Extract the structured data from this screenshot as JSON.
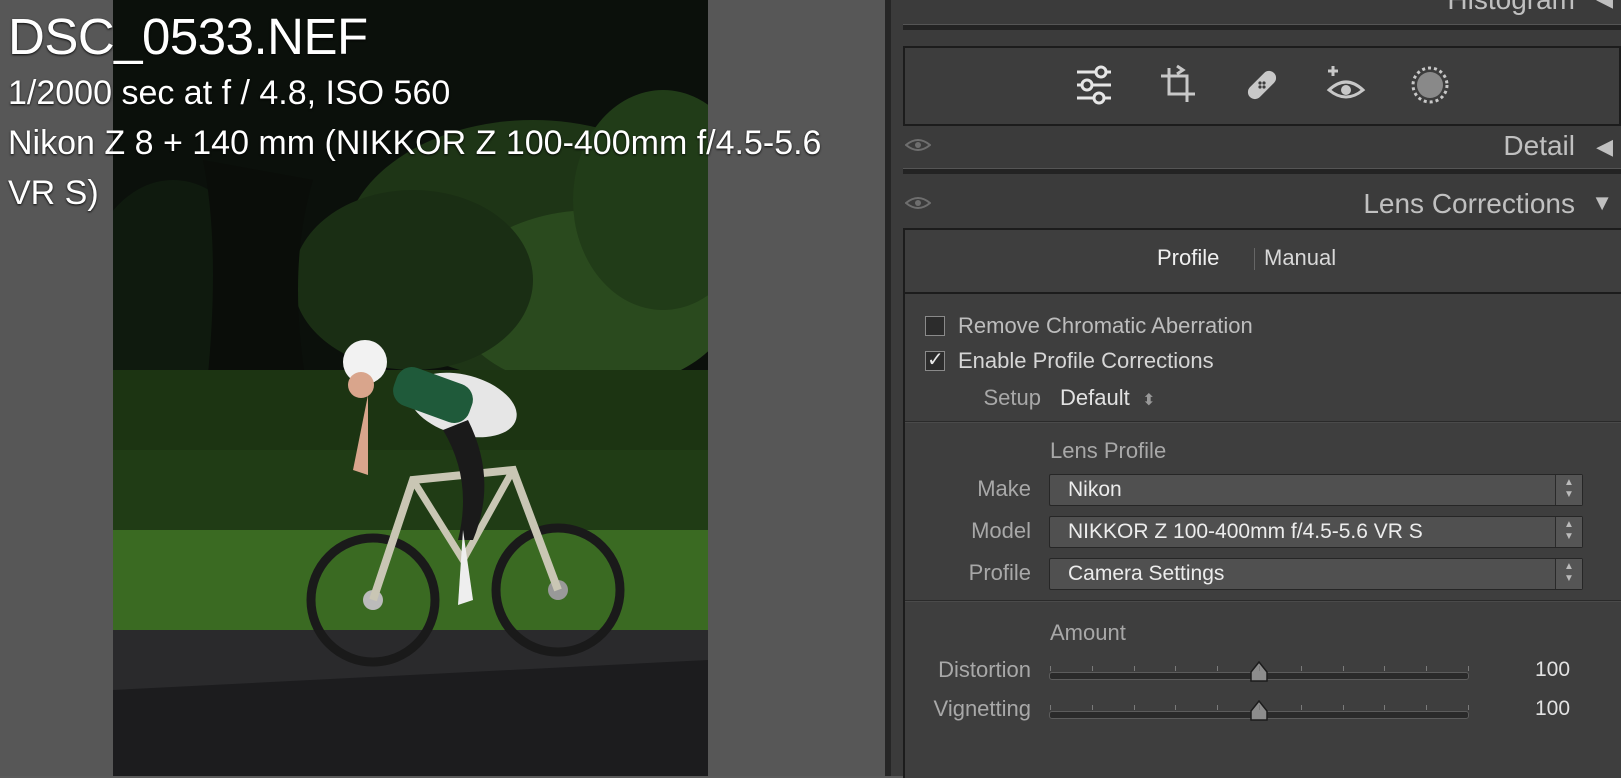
{
  "image_info": {
    "filename": "DSC_0533.NEF",
    "exposure": "1/2000 sec at f / 4.8, ISO 560",
    "camera": "Nikon Z 8 + 140 mm (NIKKOR Z 100-400mm f/4.5-5.6 VR S)"
  },
  "panels": {
    "histogram": {
      "title": "Histogram",
      "arrow": "◀"
    },
    "detail": {
      "title": "Detail",
      "arrow": "◀"
    },
    "lens_corrections": {
      "title": "Lens Corrections",
      "arrow": "▼"
    }
  },
  "tools": [
    "edit-sliders-icon",
    "crop-icon",
    "healing-bandage-icon",
    "red-eye-icon",
    "masking-icon"
  ],
  "lens": {
    "tabs": {
      "profile": "Profile",
      "manual": "Manual",
      "active": "Profile"
    },
    "remove_ca": {
      "label": "Remove Chromatic Aberration",
      "checked": false
    },
    "enable_profile": {
      "label": "Enable Profile Corrections",
      "checked": true,
      "checkmark": "✓"
    },
    "setup": {
      "label": "Setup",
      "value": "Default",
      "arrows": "⬍"
    },
    "lens_profile": {
      "section": "Lens Profile",
      "make_label": "Make",
      "make": "Nikon",
      "model_label": "Model",
      "model": "NIKKOR Z 100-400mm f/4.5-5.6 VR S",
      "profile_label": "Profile",
      "profile": "Camera Settings"
    },
    "amount": {
      "section": "Amount",
      "distortion_label": "Distortion",
      "distortion": "100",
      "vignetting_label": "Vignetting",
      "vignetting": "100"
    },
    "slider_levels": {
      "distortion": 0.5,
      "vignetting": 0.5
    }
  },
  "colors": {
    "panel_bg": "#3b3b3b",
    "text": "#c8c8c8",
    "photo_grass": "#2f5a1c"
  }
}
